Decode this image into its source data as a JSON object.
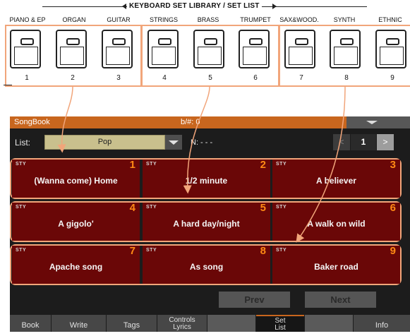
{
  "library": {
    "title": "KEYBOARD SET LIBRARY / SET LIST",
    "categories": [
      "PIANO & EP",
      "ORGAN",
      "GUITAR",
      "STRINGS",
      "BRASS",
      "TRUMPET",
      "SAX&WOOD.",
      "SYNTH",
      "ETHNIC"
    ],
    "buttons": [
      "1",
      "2",
      "3",
      "4",
      "5",
      "6",
      "7",
      "8",
      "9"
    ]
  },
  "display": {
    "title": "SongBook",
    "transpose": "b/#: 0",
    "list_label": "List:",
    "list_value": "Pop",
    "n_label": "N: - - -",
    "page_prev_icon": "chevron-left-icon",
    "page_next_icon": "chevron-right-icon",
    "page_prev": "<",
    "page_next": ">",
    "page_number": "1",
    "sty_label": "STY",
    "slots": [
      {
        "num": "1",
        "title": "(Wanna come) Home"
      },
      {
        "num": "2",
        "title": "1/2 minute"
      },
      {
        "num": "3",
        "title": "A believer"
      },
      {
        "num": "4",
        "title": "A gigolo'"
      },
      {
        "num": "5",
        "title": "A hard day/night"
      },
      {
        "num": "6",
        "title": "A walk on wild"
      },
      {
        "num": "7",
        "title": "Apache song"
      },
      {
        "num": "8",
        "title": "As song"
      },
      {
        "num": "9",
        "title": "Baker road"
      }
    ],
    "prev_button": "Prev",
    "next_button": "Next",
    "tabs": {
      "book": "Book",
      "write": "Write",
      "tags": "Tags",
      "controls_1": "Controls",
      "controls_2": "Lyrics",
      "setlist_1": "Set",
      "setlist_2": "List",
      "info": "Info"
    }
  },
  "colors": {
    "accent": "#c8661e",
    "highlight_frame": "#f1a57a",
    "slot_background": "#6a0707",
    "slot_number": "#ff8a14",
    "list_field": "#c9c08d"
  }
}
